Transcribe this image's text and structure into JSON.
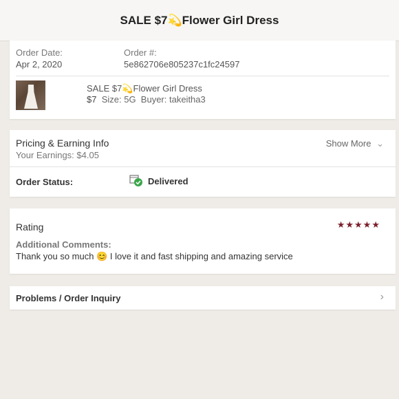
{
  "header": {
    "title": "SALE $7💫Flower Girl Dress"
  },
  "order": {
    "date_label": "Order Date:",
    "date_value": "Apr 2, 2020",
    "number_label": "Order #:",
    "number_value": "5e862706e805237c1fc24597",
    "item_title": "SALE $7💫Flower Girl Dress",
    "item_price": "$7",
    "item_size": "Size: 5G",
    "item_buyer": "Buyer: takeitha3"
  },
  "pricing": {
    "title": "Pricing & Earning Info",
    "earnings": "Your Earnings: $4.05",
    "show_more": "Show More",
    "status_label": "Order Status:",
    "status_value": "Delivered"
  },
  "rating": {
    "title": "Rating",
    "stars": "★★★★★",
    "comments_label": "Additional Comments:",
    "comment_text": "Thank you so much 😊 I love it and fast shipping and amazing service"
  },
  "problems": {
    "label": "Problems / Order Inquiry"
  },
  "colors": {
    "star": "#7b1f2b",
    "background": "#efece7",
    "delivered_check": "#3aa64a"
  }
}
